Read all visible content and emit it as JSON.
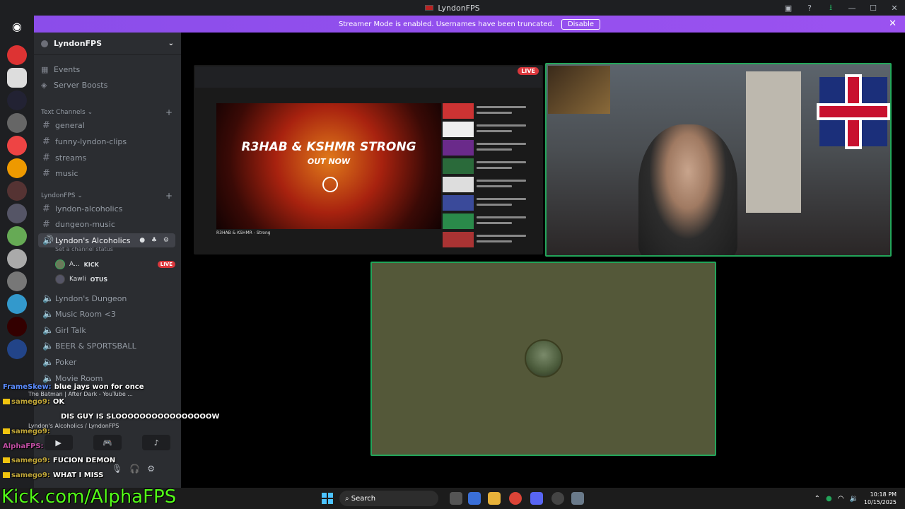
{
  "window": {
    "title": "LyndonFPS"
  },
  "banner": {
    "text": "Streamer Mode is enabled. Usernames have been truncated.",
    "disable_label": "Disable"
  },
  "server": {
    "name": "LyndonFPS"
  },
  "nav": {
    "events": "Events",
    "boosts": "Server Boosts"
  },
  "categories": {
    "text": "Text Channels",
    "lyndon": "LyndonFPS"
  },
  "text_channels": [
    "general",
    "funny-lyndon-clips",
    "streams",
    "music"
  ],
  "lyndon_channels": [
    "lyndon-alcoholics",
    "dungeon-music"
  ],
  "active_voice": {
    "name": "Lyndon's Alcoholics",
    "status": "Set a channel status"
  },
  "voice_users": [
    {
      "name": "A...",
      "tag": "KICK",
      "live": "LIVE"
    },
    {
      "name": "Kawli",
      "tag": "OTUS"
    }
  ],
  "voice_channels": [
    "Lyndon's Dungeon",
    "Music Room <3",
    "Girl Talk",
    "BEER & SPORTSBALL",
    "Poker",
    "Movie Room"
  ],
  "screen_share": {
    "live": "LIVE",
    "video_title_line1": "R3HAB & KSHMR STRONG",
    "video_title_line2": "OUT NOW",
    "caption": "R3HAB & KSHMR - Strong"
  },
  "overlay": {
    "now_playing": "The Batman | After Dark - YouTube ...",
    "voice_location": "Lyndon's Alcoholics / LyndonFPS"
  },
  "chat": [
    {
      "user": "FrameSkew:",
      "text": "blue jays won for once",
      "color": "#5b8cff"
    },
    {
      "user": "samego9:",
      "text": "OK",
      "color": "#c2a83a"
    },
    {
      "user": "",
      "text": "DIS GUY IS SLOOOOOOOOOOOOOOOOW",
      "color": "#ffffff"
    },
    {
      "user": "samego9:",
      "text": "",
      "color": "#c2a83a"
    },
    {
      "user": "AlphaFPS:",
      "text": "",
      "color": "#c14ea3"
    },
    {
      "user": "samego9:",
      "text": "FUCION DEMON",
      "color": "#c2a83a"
    },
    {
      "user": "samego9:",
      "text": "WHAT I MISS",
      "color": "#c2a83a"
    }
  ],
  "kick_url": "Kick.com/AlphaFPS",
  "taskbar": {
    "search": "Search",
    "time": "10:18 PM",
    "date": "10/15/2025"
  },
  "colors": {
    "banner": "#9b52f0",
    "speaking": "#23a55a",
    "live": "#da373c",
    "kick": "#53fc18"
  }
}
